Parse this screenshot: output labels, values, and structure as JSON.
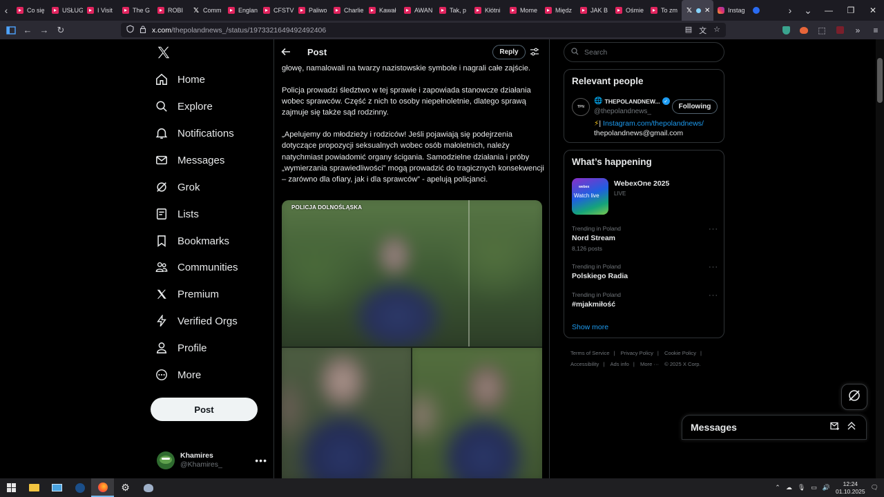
{
  "browser": {
    "tabs": [
      {
        "label": "Co się",
        "favicon": "youtube-icon"
      },
      {
        "label": "USŁUG",
        "favicon": "youtube-icon"
      },
      {
        "label": "I Visit",
        "favicon": "youtube-icon"
      },
      {
        "label": "The G",
        "favicon": "youtube-icon"
      },
      {
        "label": "ROBI",
        "favicon": "youtube-icon"
      },
      {
        "label": "Comm",
        "favicon": "x-icon"
      },
      {
        "label": "Englan",
        "favicon": "youtube-icon"
      },
      {
        "label": "CFSTV",
        "favicon": "youtube-icon"
      },
      {
        "label": "Paliwo",
        "favicon": "youtube-icon"
      },
      {
        "label": "Charlie",
        "favicon": "youtube-icon"
      },
      {
        "label": "Kawał",
        "favicon": "youtube-icon"
      },
      {
        "label": "AWAN",
        "favicon": "youtube-icon"
      },
      {
        "label": "Tak, p",
        "favicon": "youtube-icon"
      },
      {
        "label": "Kłótni",
        "favicon": "youtube-icon"
      },
      {
        "label": "Mome",
        "favicon": "youtube-icon"
      },
      {
        "label": "Międz",
        "favicon": "youtube-icon"
      },
      {
        "label": "JAK B",
        "favicon": "youtube-icon"
      },
      {
        "label": "Ośmie",
        "favicon": "youtube-icon"
      },
      {
        "label": "To zm",
        "favicon": "youtube-icon"
      }
    ],
    "active_tab_favicon": "x-icon",
    "after_tabs": [
      {
        "label": "Instag",
        "favicon": "instagram-icon"
      },
      {
        "label": "",
        "favicon": "extension-icon"
      }
    ],
    "url_host": "x.com",
    "url_path": "/thepolandnews_/status/1973321649492492406"
  },
  "nav": {
    "items": [
      {
        "label": "Home",
        "icon": "home-icon"
      },
      {
        "label": "Explore",
        "icon": "search-icon"
      },
      {
        "label": "Notifications",
        "icon": "bell-icon"
      },
      {
        "label": "Messages",
        "icon": "envelope-icon"
      },
      {
        "label": "Grok",
        "icon": "grok-icon"
      },
      {
        "label": "Lists",
        "icon": "list-icon"
      },
      {
        "label": "Bookmarks",
        "icon": "bookmark-icon"
      },
      {
        "label": "Communities",
        "icon": "communities-icon"
      },
      {
        "label": "Premium",
        "icon": "x-logo-icon"
      },
      {
        "label": "Verified Orgs",
        "icon": "lightning-icon"
      },
      {
        "label": "Profile",
        "icon": "person-icon"
      },
      {
        "label": "More",
        "icon": "more-circle-icon"
      }
    ],
    "post_label": "Post",
    "account": {
      "display_name": "Khamires",
      "handle": "@Khamires_"
    }
  },
  "post": {
    "header_title": "Post",
    "reply_label": "Reply",
    "paragraphs": [
      "głowę, namalowali na twarzy nazistowskie symbole i nagrali całe zajście.",
      "Policja prowadzi śledztwo w tej sprawie i zapowiada stanowcze działania wobec sprawców. Część z nich to osoby niepełnoletnie, dlatego sprawą zajmuje się także sąd rodzinny.",
      "„Apelujemy do młodzieży i rodziców! Jeśli pojawiają się podejrzenia dotyczące propozycji seksualnych wobec osób małoletnich, należy natychmiast powiadomić organy ścigania. Samodzielne działania i próby „wymierzania sprawiedliwości” mogą prowadzić do tragicznych konsekwencji – zarówno dla ofiary, jak i dla sprawców” - apelują policjanci."
    ],
    "media_caption": "POLICJA DOLNOŚLĄSKA"
  },
  "sidebar": {
    "search_placeholder": "Search",
    "relevant_people": {
      "heading": "Relevant people",
      "name": "THEPOLANDNEW...",
      "handle": "@thepolandnews_",
      "follow_label": "Following",
      "bio_link": "Instagram.com/thepolandnews/",
      "bio_email": "thepolandnews@gmail.com",
      "avatar_text": "TPN"
    },
    "whats_happening": {
      "heading": "What’s happening",
      "event_title": "WebexOne 2025",
      "event_status": "LIVE",
      "event_thumb_brand": "webex",
      "event_thumb_label": "Watch live",
      "trends": [
        {
          "meta": "Trending in Poland",
          "name": "Nord Stream",
          "count": "8,126 posts"
        },
        {
          "meta": "Trending in Poland",
          "name": "Polskiego Radia",
          "count": ""
        },
        {
          "meta": "Trending in Poland",
          "name": "#mjakmiłość",
          "count": ""
        }
      ],
      "show_more": "Show more"
    },
    "footer": {
      "links": [
        "Terms of Service",
        "Privacy Policy",
        "Cookie Policy",
        "Accessibility",
        "Ads info",
        "More ···"
      ],
      "copyright": "© 2025 X Corp."
    }
  },
  "messages_drawer": {
    "title": "Messages"
  },
  "taskbar": {
    "time": "12:24",
    "date": "01.10.2025"
  },
  "colors": {
    "accent": "#1d9bf0",
    "border": "#2f3336",
    "muted": "#71767b",
    "text": "#e7e9ea",
    "tab_yt": "#e0245e"
  }
}
